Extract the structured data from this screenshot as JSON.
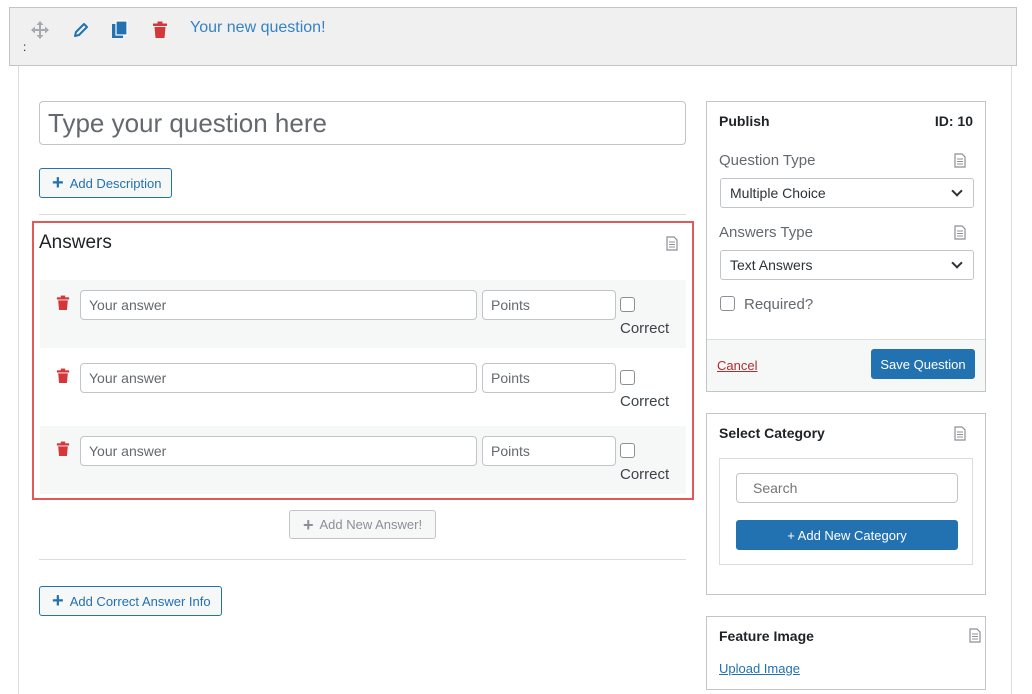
{
  "toolbar": {
    "title": "Your new question!",
    "colon": ":",
    "icons": [
      "move-icon",
      "pencil-icon",
      "copy-icon",
      "trash-icon"
    ]
  },
  "question": {
    "placeholder": "Type your question here",
    "add_description": "Add Description"
  },
  "answers": {
    "title": "Answers",
    "rows": [
      {
        "answer_placeholder": "Your answer",
        "points_placeholder": "Points",
        "correct_label": "Correct",
        "correct": false
      },
      {
        "answer_placeholder": "Your answer",
        "points_placeholder": "Points",
        "correct_label": "Correct",
        "correct": false
      },
      {
        "answer_placeholder": "Your answer",
        "points_placeholder": "Points",
        "correct_label": "Correct",
        "correct": false
      }
    ],
    "add_new_answer": "Add New Answer!",
    "add_correct_info": "Add Correct Answer Info"
  },
  "publish": {
    "title": "Publish",
    "id_label": "ID: 10",
    "question_type_label": "Question Type",
    "question_type_value": "Multiple Choice",
    "answers_type_label": "Answers Type",
    "answers_type_value": "Text Answers",
    "required_label": "Required?",
    "required": false,
    "cancel": "Cancel",
    "save": "Save Question"
  },
  "category": {
    "title": "Select Category",
    "search_placeholder": "Search",
    "add_new": "+ Add New Category"
  },
  "feature_image": {
    "title": "Feature Image",
    "upload": "Upload Image"
  },
  "colors": {
    "accent": "#2271b1",
    "danger": "#d63638",
    "highlight_border": "#e05a5a",
    "title_blue": "#3582c4"
  }
}
